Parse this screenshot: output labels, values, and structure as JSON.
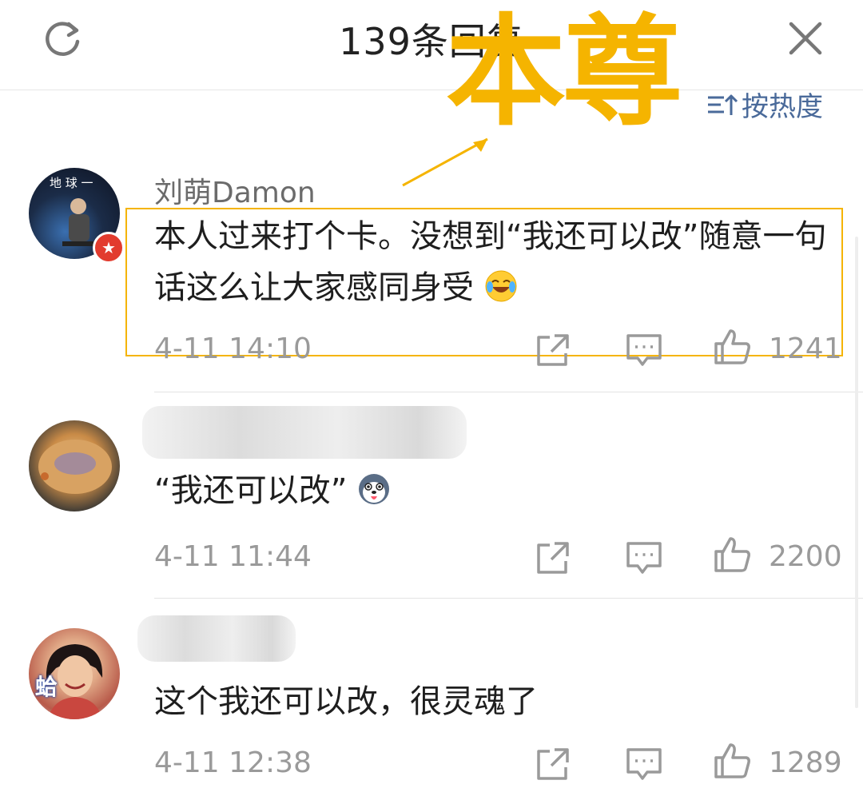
{
  "header": {
    "title": "139条回复",
    "refresh_icon": "refresh-icon",
    "close_icon": "close-icon"
  },
  "sort": {
    "label": "按热度",
    "icon": "sort-icon"
  },
  "annotation": {
    "text": "本尊",
    "color": "#f5b400"
  },
  "comments": [
    {
      "username": "刘萌Damon",
      "text": "本人过来打个卡。没想到“我还可以改”随意一句话这么让大家感同身受",
      "emoji": "laugh-cry-emoji",
      "time": "4-11 14:10",
      "likes": "1241",
      "avatar_text": "地 球 一"
    },
    {
      "username": "",
      "text": "“我还可以改”",
      "emoji": "husky-emoji",
      "time": "4-11 11:44",
      "likes": "2200",
      "username_blurred": true
    },
    {
      "username": "",
      "text": "这个我还可以改，很灵魂了",
      "emoji": "",
      "time": "4-11 12:38",
      "likes": "1289",
      "username_blurred": true,
      "avatar_text": "蛤"
    }
  ],
  "colors": {
    "accent_link": "#4a6a9a",
    "meta_gray": "#9a9a9a",
    "verified_badge": "#e23b2e"
  }
}
